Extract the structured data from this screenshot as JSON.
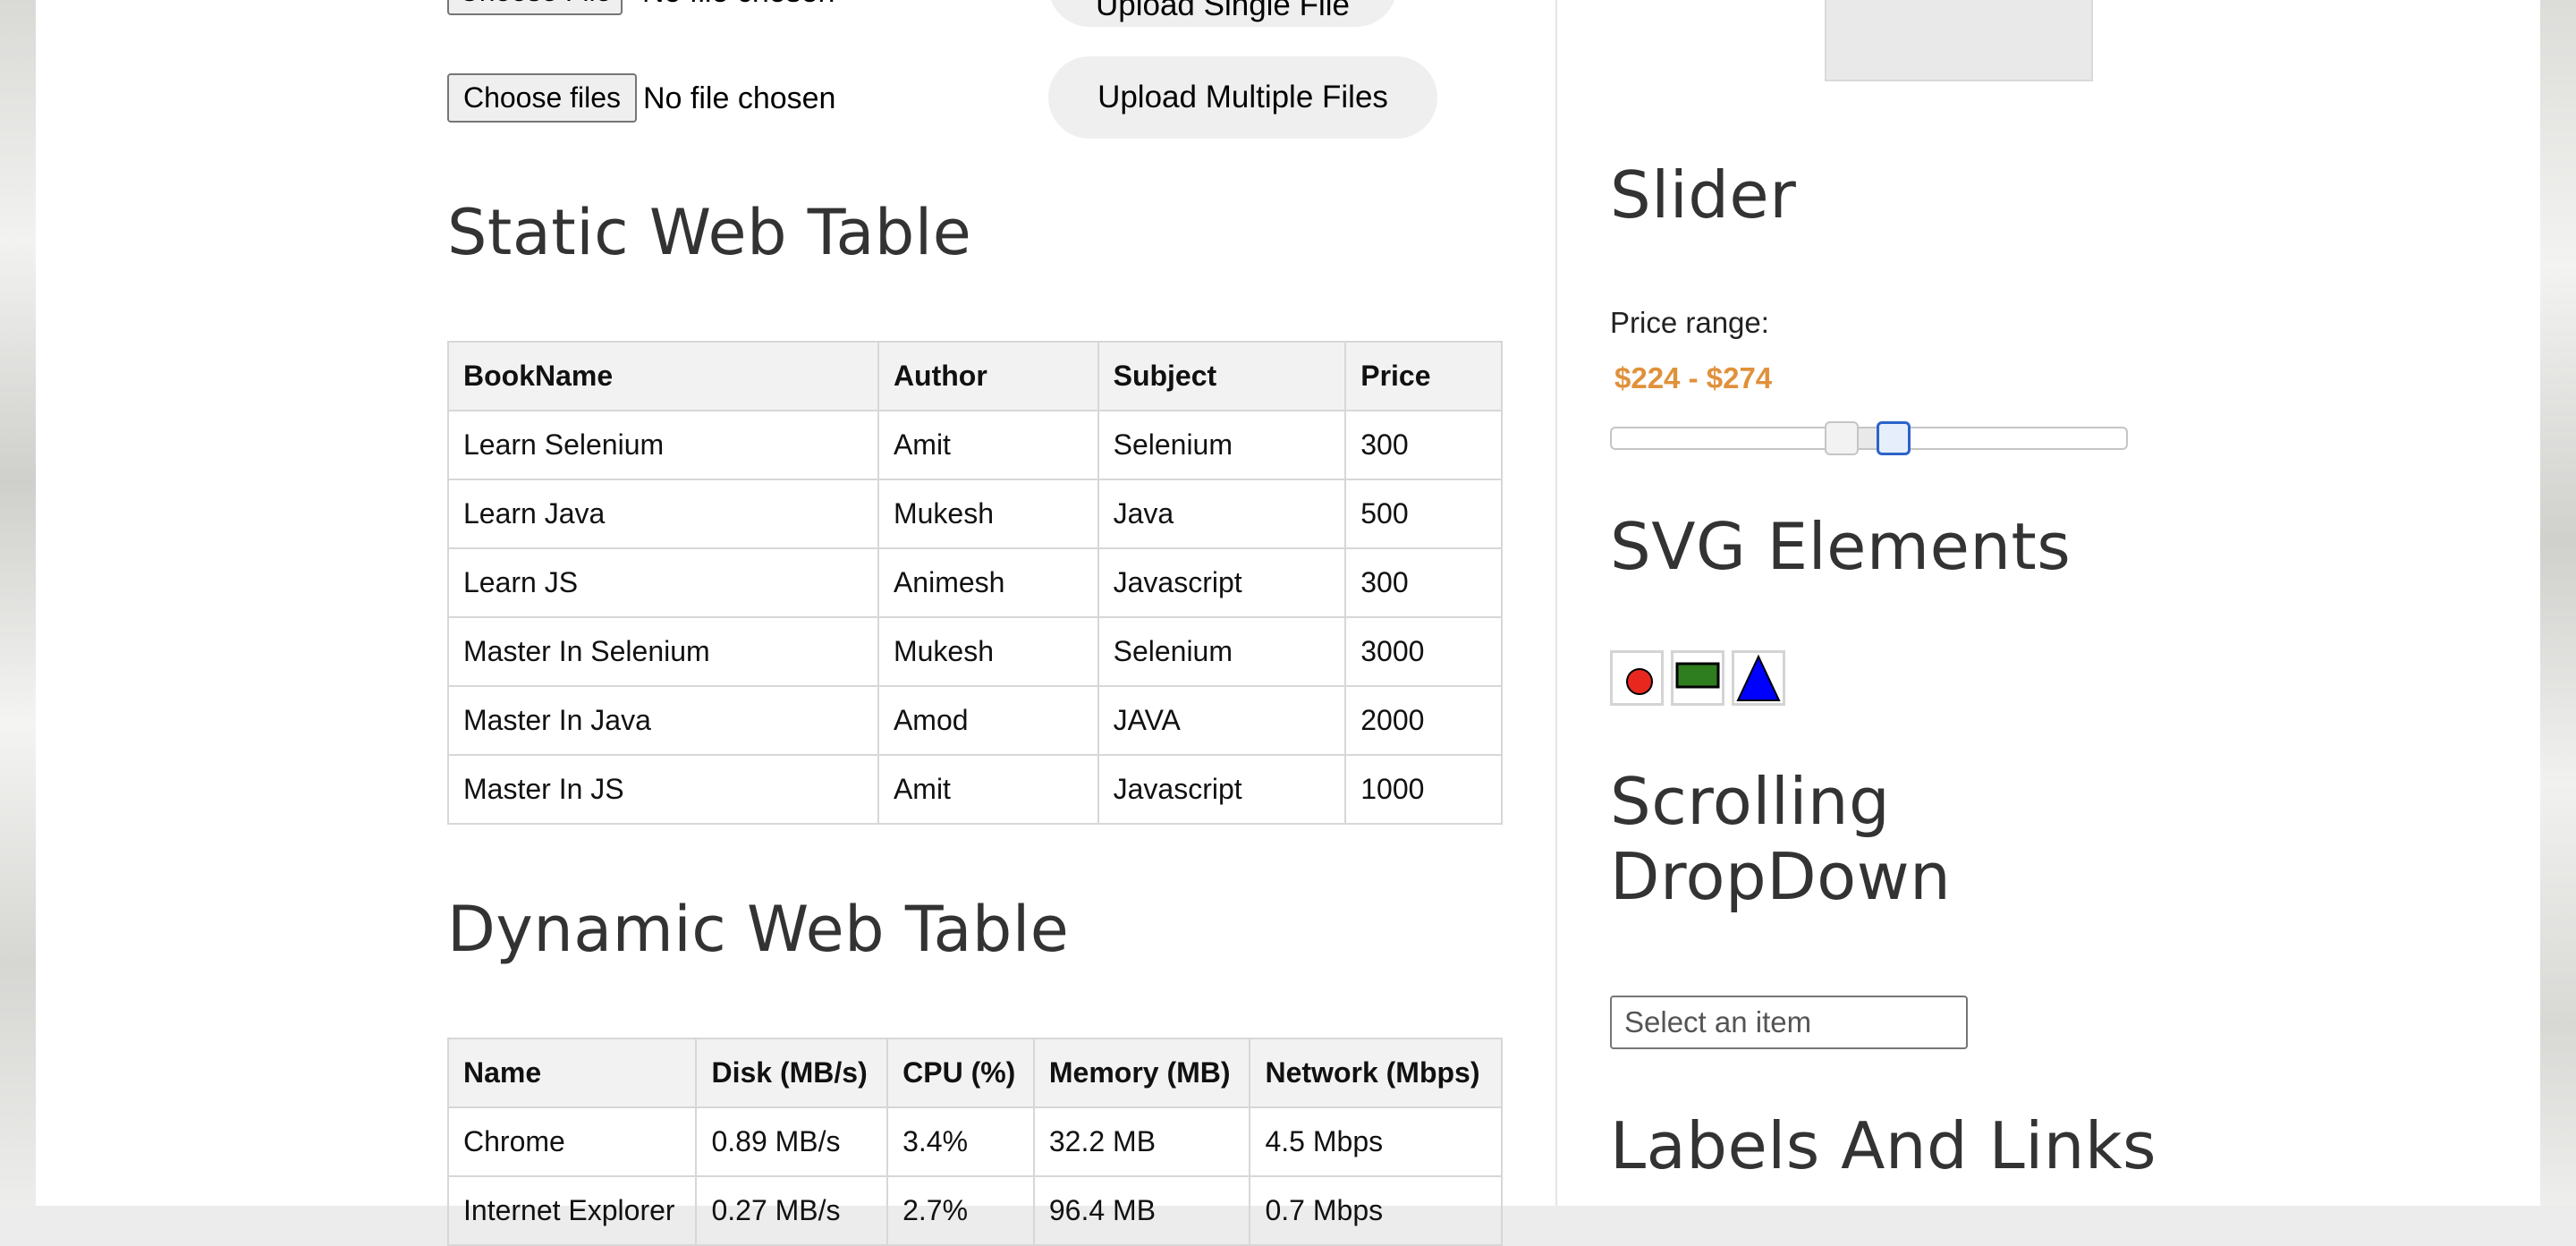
{
  "upload": {
    "single": {
      "button_label": "Choose File",
      "status": "No file chosen",
      "upload_label": "Upload Single File"
    },
    "multiple": {
      "button_label": "Choose files",
      "status": "No file chosen",
      "upload_label": "Upload Multiple Files"
    }
  },
  "static_table": {
    "title": "Static Web Table",
    "headers": [
      "BookName",
      "Author",
      "Subject",
      "Price"
    ],
    "rows": [
      [
        "Learn Selenium",
        "Amit",
        "Selenium",
        "300"
      ],
      [
        "Learn Java",
        "Mukesh",
        "Java",
        "500"
      ],
      [
        "Learn JS",
        "Animesh",
        "Javascript",
        "300"
      ],
      [
        "Master In Selenium",
        "Mukesh",
        "Selenium",
        "3000"
      ],
      [
        "Master In Java",
        "Amod",
        "JAVA",
        "2000"
      ],
      [
        "Master In JS",
        "Amit",
        "Javascript",
        "1000"
      ]
    ]
  },
  "dynamic_table": {
    "title": "Dynamic Web Table",
    "headers": [
      "Name",
      "Disk (MB/s)",
      "CPU (%)",
      "Memory (MB)",
      "Network (Mbps)"
    ],
    "rows": [
      [
        "Chrome",
        "0.89 MB/s",
        "3.4%",
        "32.2 MB",
        "4.5 Mbps"
      ],
      [
        "Internet Explorer",
        "0.27 MB/s",
        "2.7%",
        "96.4 MB",
        "0.7 Mbps"
      ]
    ]
  },
  "slider": {
    "title": "Slider",
    "label": "Price range:",
    "value_text": "$224 - $274",
    "min_value": 224,
    "max_value": 274
  },
  "svg_elements": {
    "title": "SVG Elements",
    "items": [
      "circle",
      "rectangle",
      "triangle"
    ],
    "colors": {
      "circle": "#e8281f",
      "rectangle": "#2e7d1f",
      "triangle": "#0000ff"
    }
  },
  "scrolling_dropdown": {
    "title_line1": "Scrolling",
    "title_line2": "DropDown",
    "placeholder": "Select an item"
  },
  "labels_links": {
    "title": "Labels And Links"
  },
  "colors": {
    "price_text": "#e0913b",
    "active_handle": "#2b63c9"
  }
}
